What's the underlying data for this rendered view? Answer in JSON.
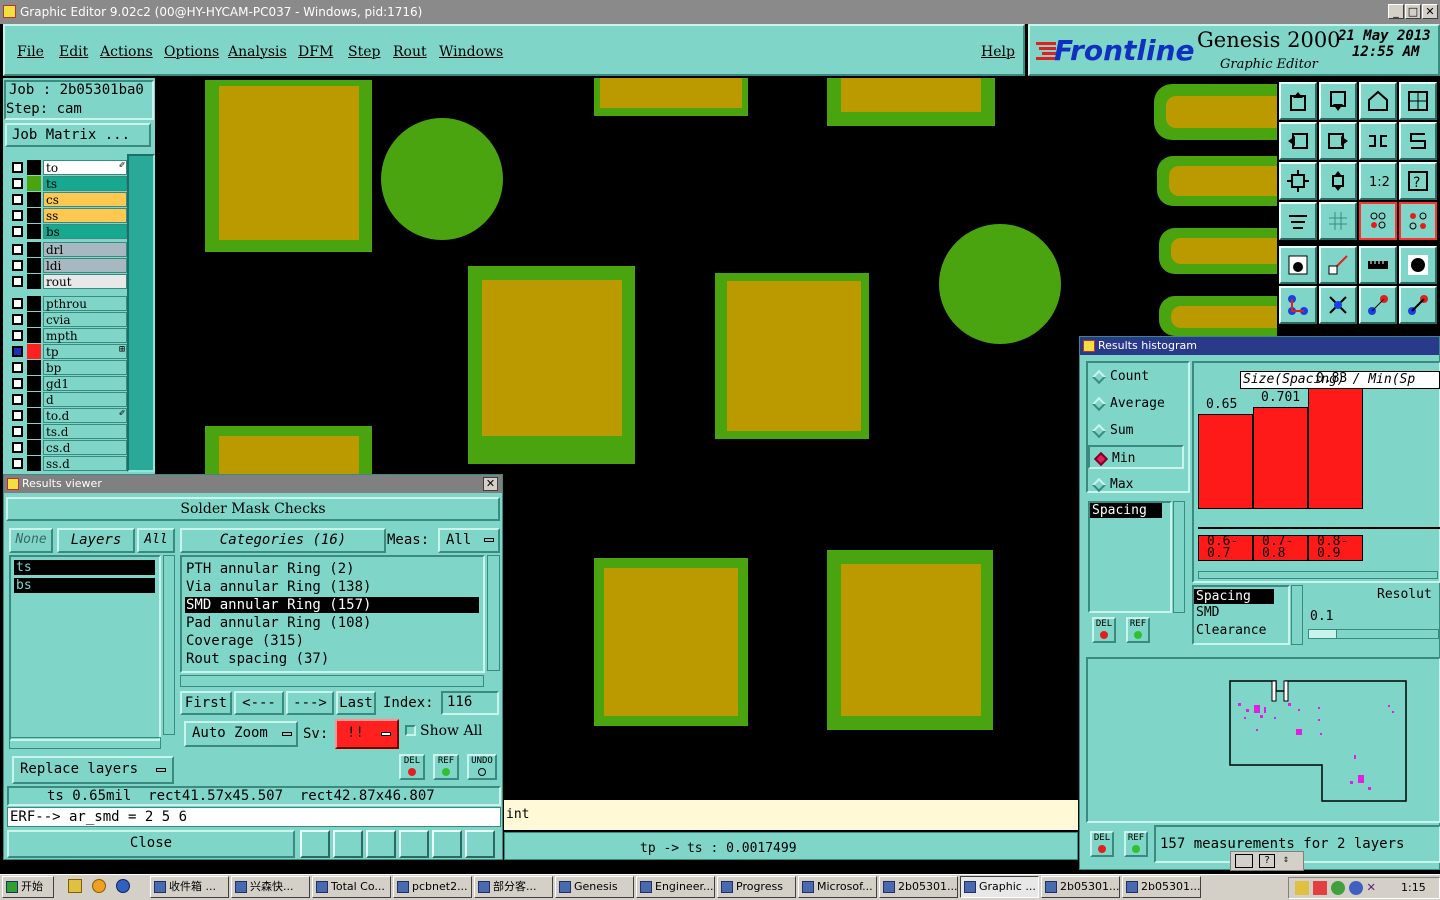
{
  "window": {
    "title": "Graphic Editor 9.02c2 (00@HY-HYCAM-PC037 - Windows, pid:1716)"
  },
  "menu": {
    "items": [
      "File",
      "Edit",
      "Actions",
      "Options",
      "Analysis",
      "DFM",
      "Step",
      "Rout",
      "Windows"
    ],
    "help": "Help"
  },
  "brand": {
    "logo": "Frontline",
    "product": "Genesis 2000",
    "subtitle": "Graphic Editor",
    "date": "21 May 2013",
    "time": "12:55 AM"
  },
  "job": {
    "job_line": "Job : 2b05301ba0",
    "step_line": "Step: cam",
    "matrix_button": "Job Matrix ..."
  },
  "layers": [
    {
      "name": "to",
      "color": "#ffffff",
      "sym": "✐"
    },
    {
      "name": "ts",
      "color": "#18a890",
      "sw": "#4aa410"
    },
    {
      "name": "cs",
      "color": "#ffc850"
    },
    {
      "name": "ss",
      "color": "#ffc850"
    },
    {
      "name": "bs",
      "color": "#18a890"
    },
    {
      "name": "drl",
      "color": "#a8b8c0"
    },
    {
      "name": "ldi",
      "color": "#a8b8c0"
    },
    {
      "name": "rout",
      "color": "#e8e8e8"
    },
    {
      "name": "pthrou",
      "color": "#7fd6c8"
    },
    {
      "name": "cvia",
      "color": "#7fd6c8"
    },
    {
      "name": "mpth",
      "color": "#7fd6c8"
    },
    {
      "name": "tp",
      "color": "#7fd6c8",
      "sw": "#ff2020",
      "sym": "⊞"
    },
    {
      "name": "bp",
      "color": "#7fd6c8"
    },
    {
      "name": "gd1",
      "color": "#7fd6c8"
    },
    {
      "name": "d",
      "color": "#7fd6c8"
    },
    {
      "name": "to.d",
      "color": "#7fd6c8",
      "sym": "✐"
    },
    {
      "name": "ts.d",
      "color": "#7fd6c8"
    },
    {
      "name": "cs.d",
      "color": "#7fd6c8"
    },
    {
      "name": "ss.d",
      "color": "#7fd6c8"
    }
  ],
  "results_viewer": {
    "title": "Results viewer",
    "heading": "Solder Mask Checks",
    "none_btn": "None",
    "layers_btn": "Layers",
    "all_btn": "All",
    "layer_list": [
      "ts",
      "bs"
    ],
    "categories_btn": "Categories (16)",
    "meas_label": "Meas:",
    "meas_value": "All",
    "categories": [
      "PTH annular Ring (2)",
      "Via annular Ring (138)",
      "SMD annular Ring (157)",
      "Pad annular Ring (108)",
      "Coverage (315)",
      "Rout spacing (37)"
    ],
    "selected_category": "SMD annular Ring (157)",
    "first": "First",
    "prev": "<---",
    "next": "--->",
    "last": "Last",
    "index_label": "Index:",
    "index_value": "116",
    "auto_zoom": "Auto Zoom",
    "sv_label": "Sv:",
    "sv_value": "!!",
    "show_all": "Show All",
    "replace_layers": "Replace layers",
    "del": "DEL",
    "ref": "REF",
    "undo": "UNDO",
    "status": "ts 0.65mil  rect41.57x45.507  rect42.87x46.807",
    "erf": "ERF--> ar_smd = 2 5 6",
    "close": "Close"
  },
  "status_bar": {
    "left": "int",
    "center": "tp -> ts : 0.0017499"
  },
  "histogram": {
    "title": "Results histogram",
    "modes": [
      "Count",
      "Average",
      "Sum",
      "Min",
      "Max"
    ],
    "selected_mode": "Min",
    "list_item": "Spacing",
    "header": "Size(Spacing) / Min(Sp",
    "types": [
      "Spacing",
      "SMD",
      "Clearance"
    ],
    "resolution_label": "Resolut",
    "resolution_value": "0.1",
    "summary": "157 measurements for 2 layers",
    "del": "DEL",
    "ref": "REF"
  },
  "chart_data": {
    "type": "bar",
    "categories": [
      "0.6-0.7",
      "0.7-0.8",
      "0.8-0.9"
    ],
    "values": [
      0.65,
      0.701,
      0.83
    ],
    "data_labels": [
      "0.65",
      "0.701",
      "0.83"
    ],
    "title": "Size(Spacing) / Min(Sp",
    "xlabel": "",
    "ylabel": "",
    "bar_color": "#ff1a1a"
  },
  "taskbar": {
    "start": "开始",
    "items": [
      "收件箱 ...",
      "兴森快...",
      "Total Co...",
      "pcbnet2...",
      "部分客...",
      "Genesis",
      "Engineer...",
      "Progress",
      "Microsof...",
      "2b05301...",
      "Graphic ...",
      "2b05301...",
      "2b05301..."
    ],
    "clock": "1:15"
  }
}
